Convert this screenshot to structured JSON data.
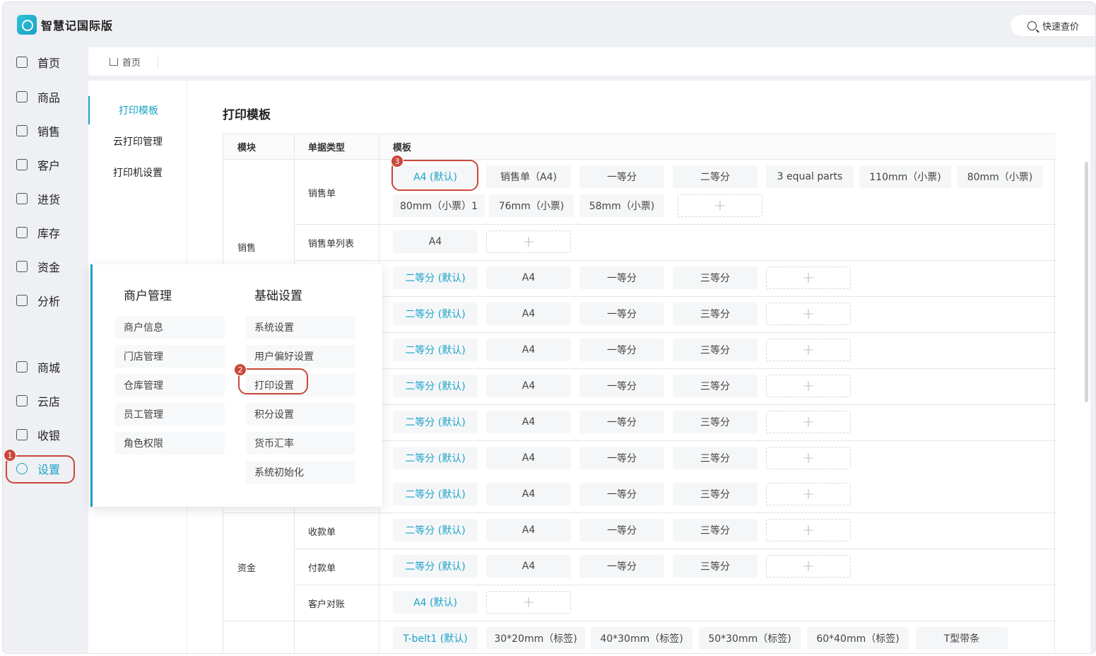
{
  "app": {
    "title": "智慧记国际版",
    "quick_search_label": "快速查价"
  },
  "nav": {
    "items": [
      {
        "label": "首页",
        "icon": "home-icon"
      },
      {
        "label": "商品",
        "icon": "bag-icon"
      },
      {
        "label": "销售",
        "icon": "clipboard-icon"
      },
      {
        "label": "客户",
        "icon": "person-icon"
      },
      {
        "label": "进货",
        "icon": "book-icon"
      },
      {
        "label": "库存",
        "icon": "warehouse-icon"
      },
      {
        "label": "资金",
        "icon": "wallet-icon"
      },
      {
        "label": "分析",
        "icon": "chart-icon"
      },
      {
        "label": "商城",
        "icon": "shop-icon"
      },
      {
        "label": "云店",
        "icon": "store-icon"
      },
      {
        "label": "收银",
        "icon": "register-icon"
      },
      {
        "label": "设置",
        "icon": "gear-icon"
      }
    ]
  },
  "breadcrumb": {
    "home": "首页"
  },
  "subnav": {
    "items": [
      "打印模板",
      "云打印管理",
      "打印机设置"
    ]
  },
  "page": {
    "title": "打印模板"
  },
  "table": {
    "headers": {
      "module": "模块",
      "doc_type": "单据类型",
      "template": "模板"
    },
    "modules": {
      "sales": "销售",
      "funds": "资金"
    },
    "doc_types": {
      "sales_order": "销售单",
      "sales_order_list": "销售单列表",
      "receipt": "收款单",
      "payment": "付款单",
      "customer_reconcile": "客户对账"
    },
    "sales_order_row1": [
      "A4 (默认)",
      "销售单（A4)",
      "一等分",
      "二等分",
      "3 equal parts",
      "110mm（小票)",
      "80mm（小票)"
    ],
    "sales_order_row2": [
      "80mm（小票）1",
      "76mm（小票)",
      "58mm（小票)"
    ],
    "list_row": [
      "A4"
    ],
    "standard_row": [
      "二等分 (默认)",
      "A4",
      "一等分",
      "三等分"
    ],
    "reconcile_row": [
      "A4 (默认)"
    ],
    "label_row": [
      "T-belt1 (默认)",
      "30*20mm（标签)",
      "40*30mm（标签)",
      "50*30mm（标签)",
      "60*40mm（标签)",
      "T型带条"
    ],
    "add_symbol": "+"
  },
  "dropdown": {
    "merchant_header": "商户管理",
    "basic_header": "基础设置",
    "merchant_items": [
      "商户信息",
      "门店管理",
      "仓库管理",
      "员工管理",
      "角色权限"
    ],
    "basic_items": [
      "系统设置",
      "用户偏好设置",
      "打印设置",
      "积分设置",
      "货币汇率",
      "系统初始化"
    ]
  },
  "annotations": {
    "step1": "1",
    "step2": "2",
    "step3": "3"
  },
  "colors": {
    "accent": "#1aa3c8",
    "highlight": "#c9473a"
  }
}
